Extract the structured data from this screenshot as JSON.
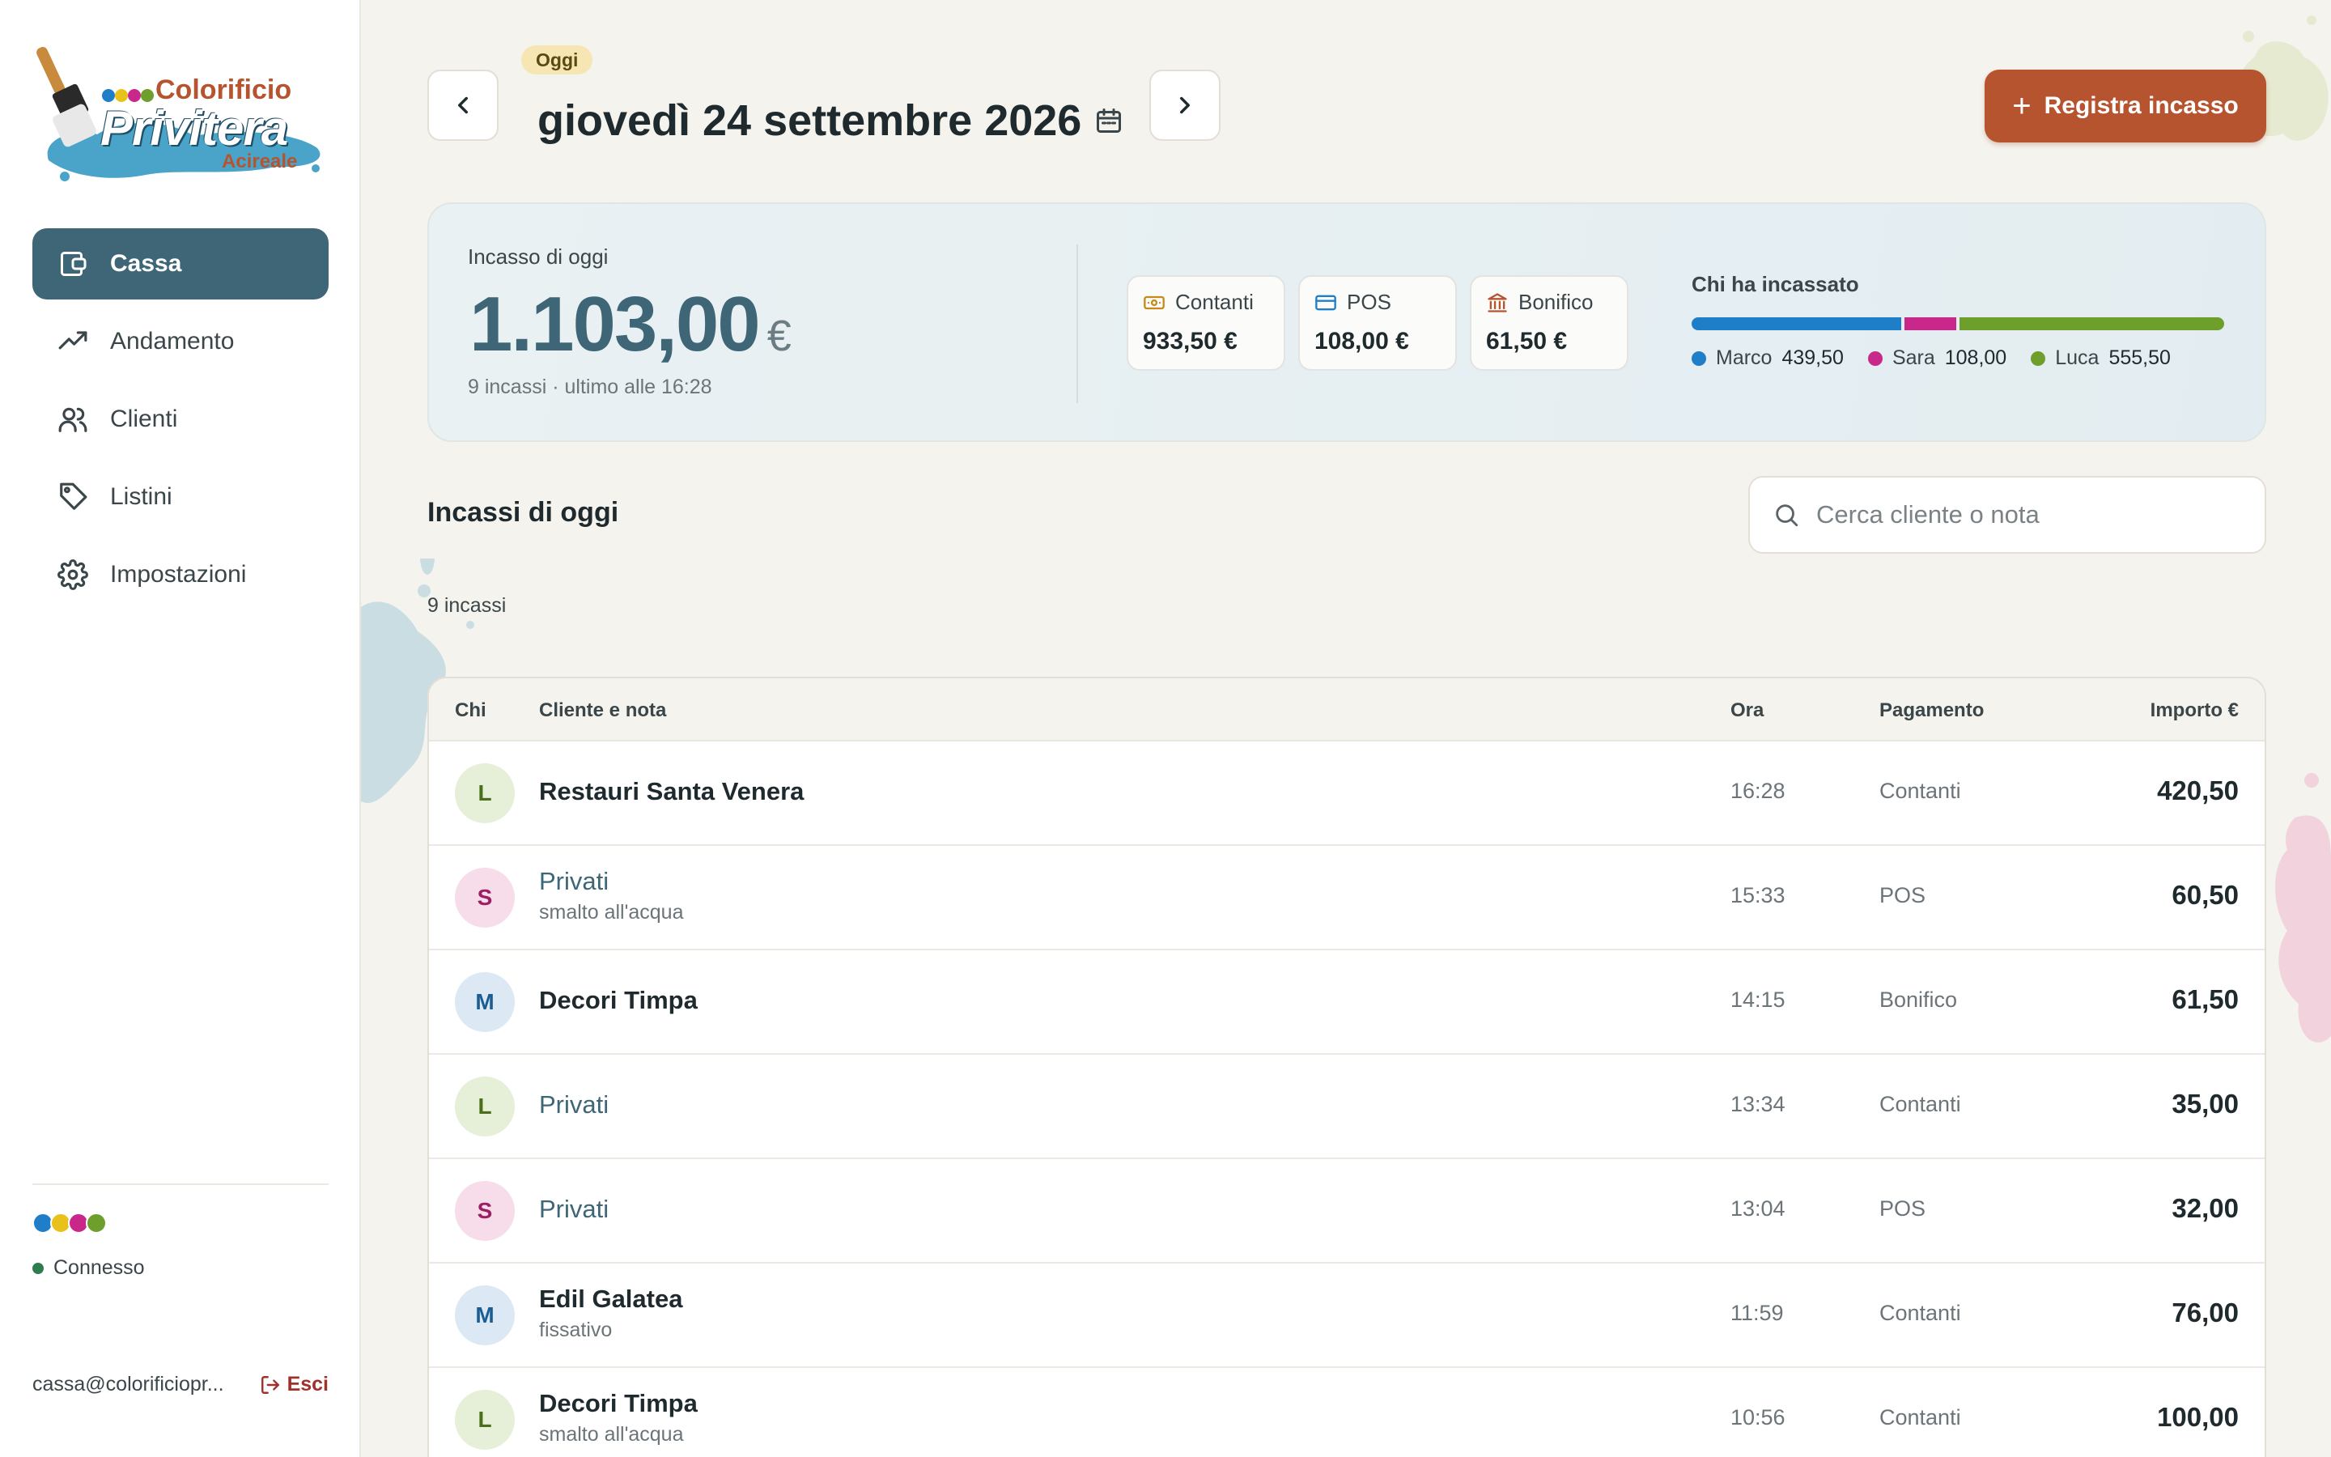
{
  "brand": {
    "name_top": "Colorificio",
    "name_main": "Privitera",
    "city": "Acireale",
    "colors": [
      "#1e7ec8",
      "#e8c21a",
      "#c7288a",
      "#6e9f2c"
    ]
  },
  "sidebar": {
    "items": [
      {
        "label": "Cassa",
        "icon": "wallet-icon",
        "active": true
      },
      {
        "label": "Andamento",
        "icon": "trending-up-icon",
        "active": false
      },
      {
        "label": "Clienti",
        "icon": "users-icon",
        "active": false
      },
      {
        "label": "Listini",
        "icon": "tag-icon",
        "active": false
      },
      {
        "label": "Impostazioni",
        "icon": "gear-icon",
        "active": false
      }
    ],
    "status": "Connesso",
    "user_email": "cassa@colorificiopr...",
    "logout_label": "Esci"
  },
  "header": {
    "badge": "Oggi",
    "date": "giovedì 24 settembre 2026",
    "primary_action": "Registra incasso"
  },
  "summary": {
    "label": "Incasso di oggi",
    "total": "1.103,00",
    "currency": "€",
    "sub": "9 incassi · ultimo alle 16:28",
    "methods": [
      {
        "label": "Contanti",
        "amount": "933,50 €",
        "icon": "cash-icon",
        "color": "#c58a1a"
      },
      {
        "label": "POS",
        "amount": "108,00 €",
        "icon": "card-icon",
        "color": "#1e7ec8"
      },
      {
        "label": "Bonifico",
        "amount": "61,50 €",
        "icon": "bank-icon",
        "color": "#b75430"
      }
    ],
    "who_title": "Chi ha incassato",
    "who": [
      {
        "name": "Marco",
        "value": "439,50",
        "amount": 439.5,
        "color": "#1e7ec8"
      },
      {
        "name": "Sara",
        "value": "108,00",
        "amount": 108.0,
        "color": "#c7288a"
      },
      {
        "name": "Luca",
        "value": "555,50",
        "amount": 555.5,
        "color": "#6e9f2c"
      }
    ]
  },
  "list": {
    "title": "Incassi di oggi",
    "count": "9 incassi",
    "search_placeholder": "Cerca cliente o nota",
    "columns": {
      "who": "Chi",
      "client": "Cliente e nota",
      "time": "Ora",
      "payment": "Pagamento",
      "amount": "Importo €"
    },
    "rows": [
      {
        "initial": "L",
        "client": "Restauri Santa Venera",
        "note": "",
        "time": "16:28",
        "payment": "Contanti",
        "amount": "420,50",
        "private": false
      },
      {
        "initial": "S",
        "client": "Privati",
        "note": "smalto all'acqua",
        "time": "15:33",
        "payment": "POS",
        "amount": "60,50",
        "private": true
      },
      {
        "initial": "M",
        "client": "Decori Timpa",
        "note": "",
        "time": "14:15",
        "payment": "Bonifico",
        "amount": "61,50",
        "private": false
      },
      {
        "initial": "L",
        "client": "Privati",
        "note": "",
        "time": "13:34",
        "payment": "Contanti",
        "amount": "35,00",
        "private": true
      },
      {
        "initial": "S",
        "client": "Privati",
        "note": "",
        "time": "13:04",
        "payment": "POS",
        "amount": "32,00",
        "private": true
      },
      {
        "initial": "M",
        "client": "Edil Galatea",
        "note": "fissativo",
        "time": "11:59",
        "payment": "Contanti",
        "amount": "76,00",
        "private": false
      },
      {
        "initial": "L",
        "client": "Decori Timpa",
        "note": "smalto all'acqua",
        "time": "10:56",
        "payment": "Contanti",
        "amount": "100,00",
        "private": false
      }
    ]
  },
  "avatar_colors": {
    "L": {
      "bg": "#e6efd8",
      "fg": "#4b6e1c"
    },
    "S": {
      "bg": "#f7dcea",
      "fg": "#9c1f66"
    },
    "M": {
      "bg": "#dce9f5",
      "fg": "#1b5c93"
    }
  }
}
